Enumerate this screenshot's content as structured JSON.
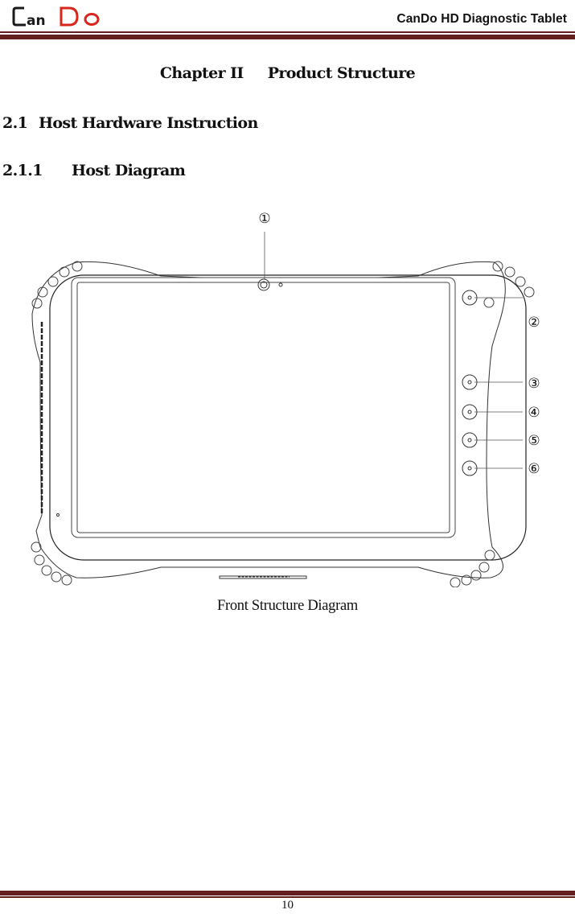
{
  "header": {
    "logo": {
      "text_part1": "Can",
      "text_part2": "Do",
      "color_dark": "#1a1a1a",
      "color_red": "#d9261c"
    },
    "title": "CanDo HD Diagnostic Tablet",
    "rule_color": "#62201f"
  },
  "content": {
    "chapter": {
      "label": "Chapter II",
      "title": "Product Structure"
    },
    "section": {
      "number": "2.1",
      "title": "Host Hardware Instruction"
    },
    "subsection": {
      "number": "2.1.1",
      "title": "Host Diagram"
    },
    "figure": {
      "caption": "Front Structure Diagram",
      "callouts": [
        {
          "id": 1,
          "label": "①",
          "part": "front-camera"
        },
        {
          "id": 2,
          "label": "②",
          "part": "side-button-2"
        },
        {
          "id": 3,
          "label": "③",
          "part": "side-button-3"
        },
        {
          "id": 4,
          "label": "④",
          "part": "side-button-4"
        },
        {
          "id": 5,
          "label": "⑤",
          "part": "side-button-5"
        },
        {
          "id": 6,
          "label": "⑥",
          "part": "side-button-6"
        }
      ]
    }
  },
  "footer": {
    "page_number": "10"
  }
}
